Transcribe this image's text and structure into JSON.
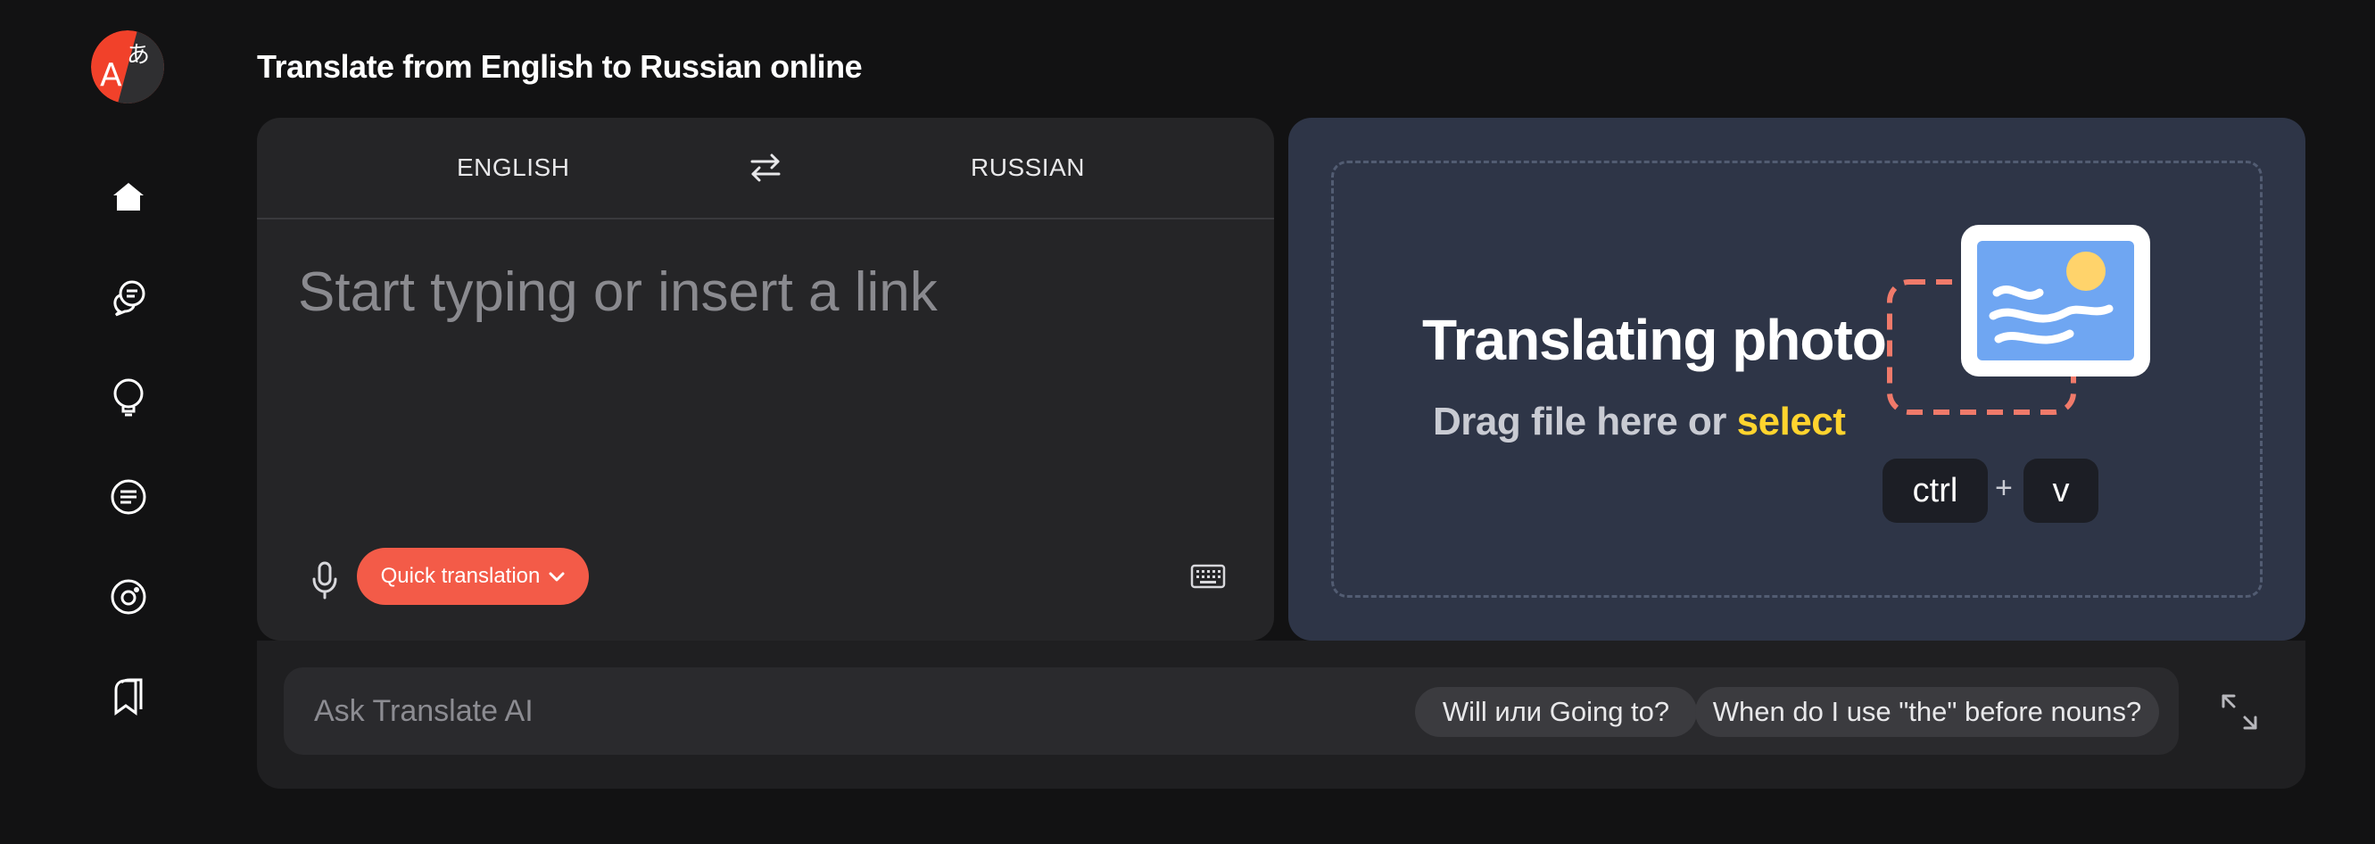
{
  "app": {
    "logo_icon": "translate-logo-icon",
    "page_title": "Translate from English to Russian online"
  },
  "sidebar": {
    "items": [
      {
        "name": "home",
        "icon": "home-icon"
      },
      {
        "name": "dialog",
        "icon": "chat-bubble-icon"
      },
      {
        "name": "dictionary",
        "icon": "lightbulb-icon"
      },
      {
        "name": "documents",
        "icon": "document-lines-icon"
      },
      {
        "name": "images",
        "icon": "camera-icon"
      },
      {
        "name": "collections",
        "icon": "bookmarks-icon"
      }
    ]
  },
  "translator": {
    "source_lang": "ENGLISH",
    "target_lang": "RUSSIAN",
    "input_value": "",
    "input_placeholder": "Start typing or insert a link",
    "quick_translation_label": "Quick translation"
  },
  "photo": {
    "title": "Translating photo",
    "subtitle_prefix": "Drag file here or ",
    "select_label": "select",
    "key1": "ctrl",
    "plus": "+",
    "key2": "v"
  },
  "ai": {
    "placeholder": "Ask Translate AI",
    "chips": [
      "Will или Going to?",
      "When do I use \"the\" before nouns?"
    ]
  },
  "colors": {
    "background": "#121213",
    "panel": "#252527",
    "photo_panel": "#2e3547",
    "accent": "#f35b48",
    "select": "#ffd42e"
  }
}
